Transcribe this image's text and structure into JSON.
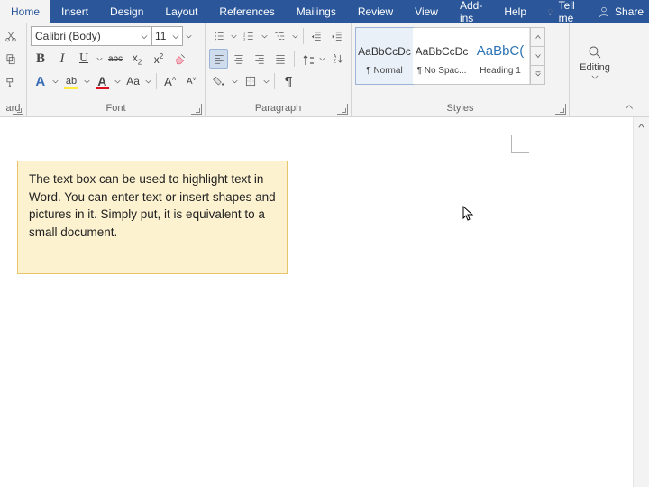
{
  "tabs": {
    "home": "Home",
    "insert": "Insert",
    "design": "Design",
    "layout": "Layout",
    "references": "References",
    "mailings": "Mailings",
    "review": "Review",
    "view": "View",
    "addins": "Add-ins",
    "help": "Help",
    "tellme": "Tell me",
    "share": "Share"
  },
  "groups": {
    "clipboard": "ard",
    "font": "Font",
    "paragraph": "Paragraph",
    "styles": "Styles",
    "editing": "Editing"
  },
  "font": {
    "name": "Calibri (Body)",
    "size": "11"
  },
  "styles": {
    "item1_preview": "AaBbCcDc",
    "item1_name": "¶ Normal",
    "item2_preview": "AaBbCcDc",
    "item2_name": "¶ No Spac...",
    "item3_preview": "AaBbC(",
    "item3_name": "Heading 1"
  },
  "editing": {
    "label": "Editing"
  },
  "document": {
    "textbox": "The text box can be used to highlight text in Word. You can enter text or insert shapes and pictures in it. Simply put, it is equivalent to a small document."
  }
}
